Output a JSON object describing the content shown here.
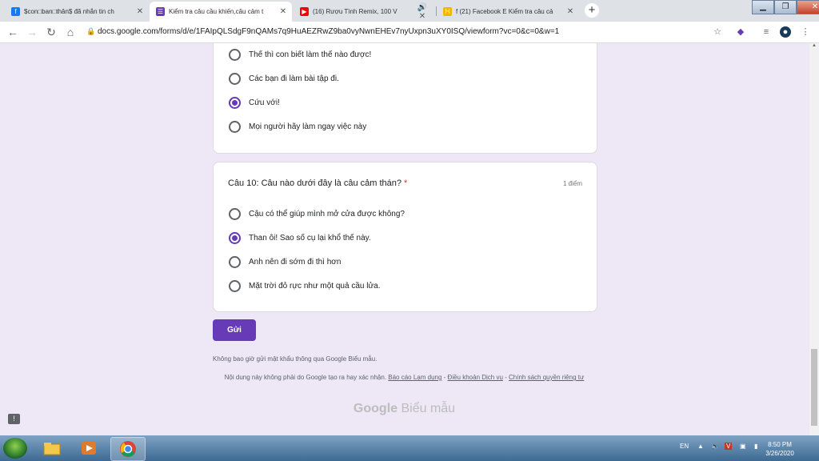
{
  "browser": {
    "tabs": [
      {
        "title": "$con□ban□thân$ đã nhắn tin ch",
        "favicon": "facebook-icon",
        "color": "#1877f2"
      },
      {
        "title": "Kiểm tra câu cầu khiến,câu cảm t",
        "favicon": "google-forms-icon",
        "color": "#673ab7"
      },
      {
        "title": "(16) Rượu Tình Remix, 100 V",
        "favicon": "youtube-icon",
        "color": "#ff0000"
      },
      {
        "title": "f (21) Facebook E Kiểm tra câu cả",
        "favicon": "hoc247-icon",
        "color": "#f4b400"
      }
    ],
    "url": "docs.google.com/forms/d/e/1FAIpQLSdgF9nQAMs7q9HuAEZRwZ9ba0vyNwnEHEv7nyUxpn3uXY0ISQ/viewform?vc=0&c=0&w=1"
  },
  "form": {
    "prev_question": {
      "options": [
        {
          "label": "Thế thì con biết làm thế nào được!",
          "checked": false
        },
        {
          "label": "Các bạn đi làm bài tập đi.",
          "checked": false
        },
        {
          "label": "Cứu với!",
          "checked": true
        },
        {
          "label": "Mọi người hãy làm ngay việc này",
          "checked": false
        }
      ]
    },
    "question10": {
      "title": "Câu 10: Câu nào dưới đây là câu cảm thán?",
      "required_mark": "*",
      "points": "1 điểm",
      "options": [
        {
          "label": "Cậu có thể giúp mình mở cửa được không?",
          "checked": false
        },
        {
          "label": "Than ôi! Sao số cụ lại khổ thế này.",
          "checked": true
        },
        {
          "label": "Anh nên đi sớm đi thì hơn",
          "checked": false
        },
        {
          "label": "Mặt trời đỏ rực như một quả cầu lửa.",
          "checked": false
        }
      ]
    },
    "submit_label": "Gửi",
    "footer_warning": "Không bao giờ gửi mật khẩu thông qua Google Biểu mẫu.",
    "footer_disclaimer": "Nội dung này không phải do Google tạo ra hay xác nhận.",
    "footer_links": {
      "report": "Báo cáo Lạm dụng",
      "terms": "Điều khoản Dịch vụ",
      "privacy": "Chính sách quyền riêng tư"
    },
    "brand_google": "Google",
    "brand_forms": "Biểu mẫu"
  },
  "taskbar": {
    "lang": "EN",
    "time": "8:50 PM",
    "date": "3/26/2020"
  }
}
